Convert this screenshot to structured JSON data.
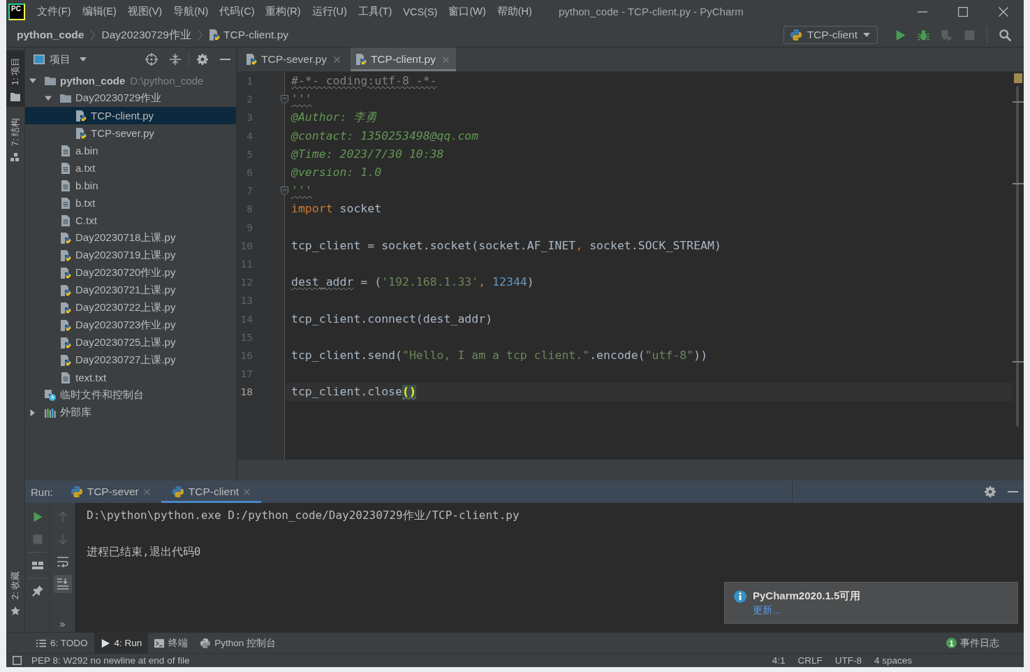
{
  "window": {
    "logo": "PC",
    "title": "python_code - TCP-client.py - PyCharm"
  },
  "menu": [
    "文件(F)",
    "编辑(E)",
    "视图(V)",
    "导航(N)",
    "代码(C)",
    "重构(R)",
    "运行(U)",
    "工具(T)",
    "VCS(S)",
    "窗口(W)",
    "帮助(H)"
  ],
  "breadcrumbs": [
    {
      "label": "python_code",
      "kind": "project"
    },
    {
      "label": "Day20230729作业",
      "kind": "folder"
    },
    {
      "label": "TCP-client.py",
      "kind": "python"
    }
  ],
  "toolbar": {
    "run_config": "TCP-client",
    "buttons": [
      {
        "kind": "run",
        "disabled": false
      },
      {
        "kind": "debug",
        "disabled": false
      },
      {
        "kind": "coverage",
        "disabled": true
      },
      {
        "kind": "stop",
        "disabled": true
      },
      {
        "kind": "search",
        "disabled": false
      }
    ]
  },
  "left_stripe": {
    "top": [
      {
        "label": "1: 项目",
        "kind": "project",
        "selected": true
      },
      {
        "label": "7: 结构",
        "kind": "structure",
        "selected": false
      }
    ],
    "bottom": [
      {
        "label": "2: 收藏",
        "kind": "favorites",
        "selected": false
      }
    ]
  },
  "project_panel": {
    "title": "项目",
    "tree": [
      {
        "name": "python_code",
        "path": "D:\\python_code",
        "kind": "project",
        "expanded": true,
        "selected": false,
        "children": [
          {
            "name": "Day20230729作业",
            "kind": "folder",
            "expanded": true,
            "selected": false,
            "children": [
              {
                "name": "TCP-client.py",
                "kind": "python",
                "selected": true
              },
              {
                "name": "TCP-sever.py",
                "kind": "python",
                "selected": false
              }
            ]
          },
          {
            "name": "a.bin",
            "kind": "text",
            "selected": false
          },
          {
            "name": "a.txt",
            "kind": "text",
            "selected": false
          },
          {
            "name": "b.bin",
            "kind": "text",
            "selected": false
          },
          {
            "name": "b.txt",
            "kind": "text",
            "selected": false
          },
          {
            "name": "C.txt",
            "kind": "text",
            "selected": false
          },
          {
            "name": "Day20230718上课.py",
            "kind": "python",
            "selected": false
          },
          {
            "name": "Day20230719上课.py",
            "kind": "python",
            "selected": false
          },
          {
            "name": "Day20230720作业.py",
            "kind": "python",
            "selected": false
          },
          {
            "name": "Day20230721上课.py",
            "kind": "python",
            "selected": false
          },
          {
            "name": "Day20230722上课.py",
            "kind": "python",
            "selected": false
          },
          {
            "name": "Day20230723作业.py",
            "kind": "python",
            "selected": false
          },
          {
            "name": "Day20230725上课.py",
            "kind": "python",
            "selected": false
          },
          {
            "name": "Day20230727上课.py",
            "kind": "python",
            "selected": false
          },
          {
            "name": "text.txt",
            "kind": "text",
            "selected": false
          }
        ]
      },
      {
        "name": "临时文件和控制台",
        "kind": "scratch",
        "selected": false
      },
      {
        "name": "外部库",
        "kind": "library",
        "expanded": false,
        "selected": false
      }
    ]
  },
  "editor": {
    "tabs": [
      {
        "label": "TCP-sever.py",
        "selected": false
      },
      {
        "label": "TCP-client.py",
        "selected": true
      }
    ],
    "lines": [
      {
        "number": "1",
        "current": false,
        "fold": false,
        "tokens": [
          {
            "text": "#-*- coding:utf-8 -*-",
            "kind": "comment",
            "warning": true
          }
        ]
      },
      {
        "number": "2",
        "current": false,
        "fold": true,
        "tokens": [
          {
            "text": "'''",
            "kind": "docstring",
            "warning": true
          }
        ]
      },
      {
        "number": "3",
        "current": false,
        "fold": false,
        "tokens": [
          {
            "text": "@Author: 李勇",
            "kind": "docstring",
            "warning": false
          }
        ]
      },
      {
        "number": "4",
        "current": false,
        "fold": false,
        "tokens": [
          {
            "text": "@contact: 1350253498@qq.com",
            "kind": "docstring",
            "warning": false
          }
        ]
      },
      {
        "number": "5",
        "current": false,
        "fold": false,
        "tokens": [
          {
            "text": "@Time: 2023/7/30 10:38",
            "kind": "docstring",
            "warning": false
          }
        ]
      },
      {
        "number": "6",
        "current": false,
        "fold": false,
        "tokens": [
          {
            "text": "@version: 1.0",
            "kind": "docstring",
            "warning": false
          }
        ]
      },
      {
        "number": "7",
        "current": false,
        "fold": true,
        "tokens": [
          {
            "text": "'''",
            "kind": "docstring",
            "warning": true
          }
        ]
      },
      {
        "number": "8",
        "current": false,
        "fold": false,
        "tokens": [
          {
            "text": "import",
            "kind": "keyword",
            "warning": false
          },
          {
            "text": " socket",
            "kind": "plain",
            "warning": false
          }
        ]
      },
      {
        "number": "9",
        "current": false,
        "fold": false
      },
      {
        "number": "10",
        "current": false,
        "fold": false,
        "tokens": [
          {
            "text": "tcp_client = socket.socket(socket.AF_INET",
            "kind": "plain",
            "warning": false
          },
          {
            "text": ", ",
            "kind": "comma",
            "warning": false
          },
          {
            "text": "socket.SOCK_STREAM)",
            "kind": "plain",
            "warning": false
          }
        ]
      },
      {
        "number": "11",
        "current": false,
        "fold": false
      },
      {
        "number": "12",
        "current": false,
        "fold": false,
        "tokens": [
          {
            "text": "dest_addr",
            "kind": "plain",
            "warning": true
          },
          {
            "text": " = (",
            "kind": "plain",
            "warning": false
          },
          {
            "text": "'192.168.1.33'",
            "kind": "string",
            "warning": false
          },
          {
            "text": ", ",
            "kind": "comma",
            "warning": false
          },
          {
            "text": "12344",
            "kind": "number",
            "warning": false
          },
          {
            "text": ")",
            "kind": "plain",
            "warning": false
          }
        ]
      },
      {
        "number": "13",
        "current": false,
        "fold": false
      },
      {
        "number": "14",
        "current": false,
        "fold": false,
        "tokens": [
          {
            "text": "tcp_client.connect(dest_addr)",
            "kind": "plain",
            "warning": false
          }
        ]
      },
      {
        "number": "15",
        "current": false,
        "fold": false
      },
      {
        "number": "16",
        "current": false,
        "fold": false,
        "tokens": [
          {
            "text": "tcp_client.send(",
            "kind": "plain",
            "warning": false
          },
          {
            "text": "\"Hello, I am a tcp client.\"",
            "kind": "string",
            "warning": false
          },
          {
            "text": ".encode(",
            "kind": "plain",
            "warning": false
          },
          {
            "text": "\"utf-8\"",
            "kind": "string",
            "warning": false
          },
          {
            "text": "))",
            "kind": "plain",
            "warning": false
          }
        ]
      },
      {
        "number": "17",
        "current": false,
        "fold": false
      },
      {
        "number": "18",
        "current": true,
        "fold": false,
        "tokens": [
          {
            "text": "tcp_client.close",
            "kind": "plain",
            "warning": false
          },
          {
            "text": "()",
            "kind": "brace",
            "warning": true
          }
        ]
      }
    ]
  },
  "run": {
    "label": "Run:",
    "tabs": [
      {
        "label": "TCP-sever",
        "selected": false
      },
      {
        "label": "TCP-client",
        "selected": true
      }
    ],
    "actions": [
      {
        "kind": "rerun",
        "disabled": false
      },
      {
        "kind": "stop",
        "disabled": true
      },
      {
        "kind": "layout",
        "disabled": false
      },
      {
        "kind": "pin",
        "disabled": false
      }
    ],
    "console_actions": [
      {
        "kind": "up",
        "disabled": true,
        "on": false
      },
      {
        "kind": "down",
        "disabled": true,
        "on": false
      },
      {
        "kind": "wrap",
        "disabled": false,
        "on": false
      },
      {
        "kind": "scroll_end",
        "disabled": false,
        "on": true
      }
    ],
    "more": "»",
    "console": [
      "D:\\python\\python.exe D:/python_code/Day20230729作业/TCP-client.py",
      "进程已结束,退出代码0"
    ]
  },
  "notification": {
    "title": "PyCharm2020.1.5可用",
    "link": "更新..."
  },
  "tool_windows": [
    {
      "label": "6: TODO",
      "kind": "todo",
      "selected": false
    },
    {
      "label": "4: Run",
      "kind": "run",
      "selected": true
    },
    {
      "label": "终端",
      "kind": "terminal",
      "selected": false
    },
    {
      "label": "Python 控制台",
      "kind": "python",
      "selected": false
    }
  ],
  "event_log": {
    "count": "1",
    "label": "事件日志"
  },
  "status_bar": {
    "message": "PEP 8: W292 no newline at end of file",
    "items": [
      "4:1",
      "CRLF",
      "UTF-8",
      "4 spaces"
    ]
  }
}
